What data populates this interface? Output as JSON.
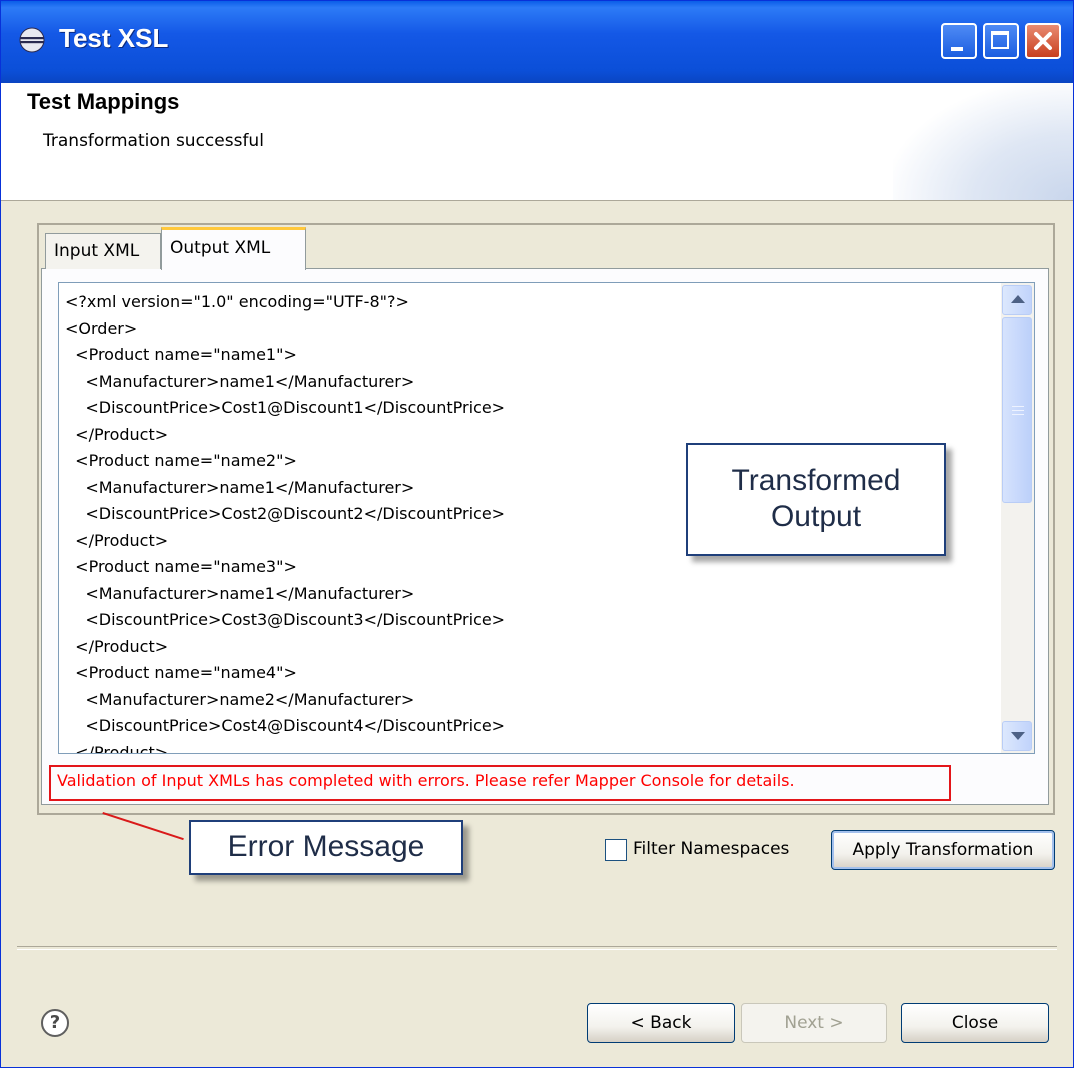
{
  "window": {
    "title": "Test XSL",
    "icon": "eclipse-icon",
    "controls": [
      "minimize-icon",
      "maximize-icon",
      "close-icon"
    ]
  },
  "header": {
    "title": "Test Mappings",
    "message": "Transformation successful"
  },
  "tabs": [
    {
      "label": "Input XML",
      "selected": false
    },
    {
      "label": "Output XML",
      "selected": true
    }
  ],
  "output_xml": [
    "<?xml version=\"1.0\" encoding=\"UTF-8\"?>",
    "<Order>",
    "  <Product name=\"name1\">",
    "    <Manufacturer>name1</Manufacturer>",
    "    <DiscountPrice>Cost1@Discount1</DiscountPrice>",
    "  </Product>",
    "  <Product name=\"name2\">",
    "    <Manufacturer>name1</Manufacturer>",
    "    <DiscountPrice>Cost2@Discount2</DiscountPrice>",
    "  </Product>",
    "  <Product name=\"name3\">",
    "    <Manufacturer>name1</Manufacturer>",
    "    <DiscountPrice>Cost3@Discount3</DiscountPrice>",
    "  </Product>",
    "  <Product name=\"name4\">",
    "    <Manufacturer>name2</Manufacturer>",
    "    <DiscountPrice>Cost4@Discount4</DiscountPrice>",
    "  </Product>"
  ],
  "error_message": "Validation of Input XMLs has completed with errors. Please refer Mapper Console for details.",
  "callouts": {
    "output_line1": "Transformed",
    "output_line2": "Output",
    "error": "Error Message"
  },
  "controls": {
    "filter_namespaces_label": "Filter Namespaces",
    "filter_namespaces_checked": false,
    "apply_label": "Apply Transformation"
  },
  "footer": {
    "help_glyph": "?",
    "back_label": "< Back",
    "next_label": "Next >",
    "next_enabled": false,
    "close_label": "Close"
  },
  "colors": {
    "titlebar": "#0b4fd8",
    "error_red": "#ff0000",
    "tab_accent": "#ffc83c",
    "callout_border": "#1f3f7a"
  }
}
